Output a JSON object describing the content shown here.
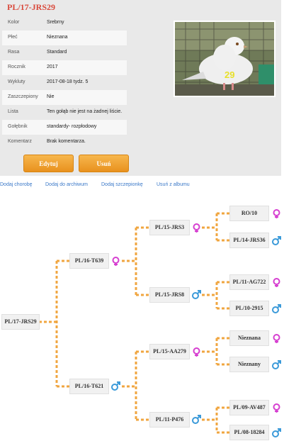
{
  "title": "PL/17-JRS29",
  "details": [
    {
      "label": "Kolor",
      "value": "Srebrny"
    },
    {
      "label": "Płeć",
      "value": "Nieznana"
    },
    {
      "label": "Rasa",
      "value": "Standard"
    },
    {
      "label": "Rocznik",
      "value": "2017"
    },
    {
      "label": "Wykluty",
      "value": "2017-08-18 tydz. 5"
    },
    {
      "label": "Zaszczepiony",
      "value": "Nie"
    },
    {
      "label": "Lista",
      "value": "Ten gołąb nie jest na żadnej liście."
    },
    {
      "label": "Gołębnik",
      "value": "standardy- rozpłodowy"
    },
    {
      "label": "Komentarz",
      "value": "Brak komentarza."
    }
  ],
  "photo": {
    "ring_number": "29"
  },
  "buttons": {
    "edit": "Edytuj",
    "delete": "Usuń"
  },
  "links": [
    "Dodaj chorobę",
    "Dodaj do archiwum",
    "Dodaj szczepionkę",
    "Usuń z albumu"
  ],
  "pedigree": {
    "root": "PL/17-JRS29",
    "parents": [
      {
        "ring": "PL/16-T639",
        "sex": "female"
      },
      {
        "ring": "PL/16-T621",
        "sex": "male"
      }
    ],
    "grandparents": [
      {
        "ring": "PL/15-JRS3",
        "sex": "female"
      },
      {
        "ring": "PL/15-JRS8",
        "sex": "male"
      },
      {
        "ring": "PL/15-AA279",
        "sex": "female"
      },
      {
        "ring": "PL/11-P476",
        "sex": "male"
      }
    ],
    "great_grandparents": [
      {
        "ring": "RO/10",
        "sex": "female"
      },
      {
        "ring": "PL/14-JRS36",
        "sex": "male"
      },
      {
        "ring": "PL/11-AG722",
        "sex": "female"
      },
      {
        "ring": "PL/10-2915",
        "sex": "male"
      },
      {
        "ring": "Nieznana",
        "sex": "female"
      },
      {
        "ring": "Nieznany",
        "sex": "male"
      },
      {
        "ring": "PL/09-AV487",
        "sex": "female"
      },
      {
        "ring": "PL/08-18284",
        "sex": "male"
      }
    ]
  },
  "colors": {
    "accent": "#d9493b",
    "link": "#3a78c8",
    "connector": "#f0a640",
    "female": "#d63fd0",
    "male": "#3b9ad9",
    "button": "#f0a030"
  }
}
